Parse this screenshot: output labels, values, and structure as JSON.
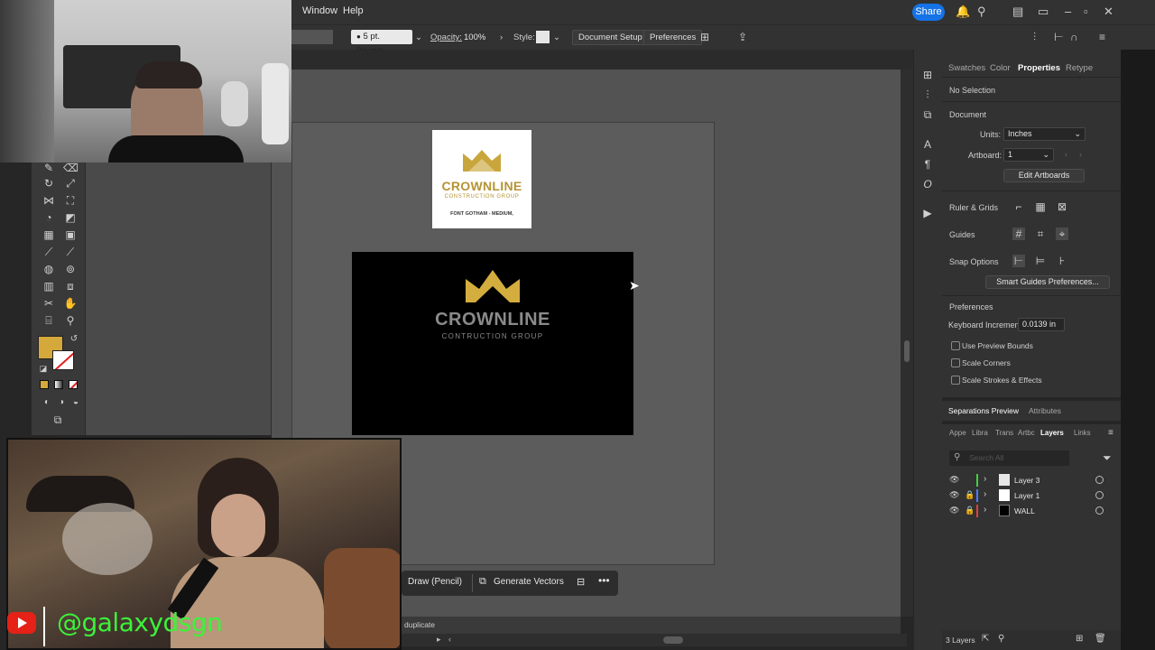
{
  "menubar": {
    "items": [
      "Window",
      "Help"
    ],
    "share_label": "Share"
  },
  "controlbar": {
    "brush_value": "5 pt. Round",
    "opacity_label": "Opacity:",
    "opacity_value": "100%",
    "style_label": "Style:",
    "document_setup": "Document Setup",
    "preferences": "Preferences"
  },
  "artwork": {
    "brand": "CROWNLINE",
    "subtitle": "CONSTRUCTION GROUP",
    "subtitle_dark": "CONTRUCTION GROUP",
    "font_note": "FONT GOTHAM - MEDIUM,",
    "gold": "#c9a63b"
  },
  "taskbar": {
    "draw_label": "Draw (Pencil)",
    "generate_label": "Generate Vectors"
  },
  "statusbar": {
    "text": "duplicate"
  },
  "panel": {
    "tabs": [
      "Swatches",
      "Color",
      "Properties",
      "Retype"
    ],
    "active_tab": "Properties",
    "selection": "No Selection",
    "document_heading": "Document",
    "units_label": "Units:",
    "units_value": "Inches",
    "artboard_label": "Artboard:",
    "artboard_value": "1",
    "edit_artboards": "Edit Artboards",
    "ruler_grids": "Ruler & Grids",
    "guides": "Guides",
    "snap_options": "Snap Options",
    "smart_guides_btn": "Smart Guides Preferences...",
    "preferences_heading": "Preferences",
    "keyboard_increment_label": "Keyboard Increment:",
    "keyboard_increment_value": "0.0139 in",
    "checkboxes": [
      "Use Preview Bounds",
      "Scale Corners",
      "Scale Strokes & Effects"
    ]
  },
  "lower_panel": {
    "tabs": [
      "Separations Preview",
      "Attributes"
    ],
    "subtabs": [
      "Appe",
      "Libra",
      "Trans",
      "Artbc",
      "Layers",
      "Links"
    ],
    "active_subtab": "Layers",
    "search_placeholder": "Search All",
    "layers": [
      {
        "name": "Layer 3",
        "color": "#3fd23f",
        "locked": false
      },
      {
        "name": "Layer 1",
        "color": "#4b7bff",
        "locked": true
      },
      {
        "name": "WALL",
        "color": "#e04040",
        "locked": true
      }
    ],
    "layer_count": "3 Layers"
  },
  "overlay": {
    "handle": "@galaxydsgn"
  },
  "colors": {
    "fill_swatch": "#d4a83a",
    "accent": "#1473e6"
  }
}
